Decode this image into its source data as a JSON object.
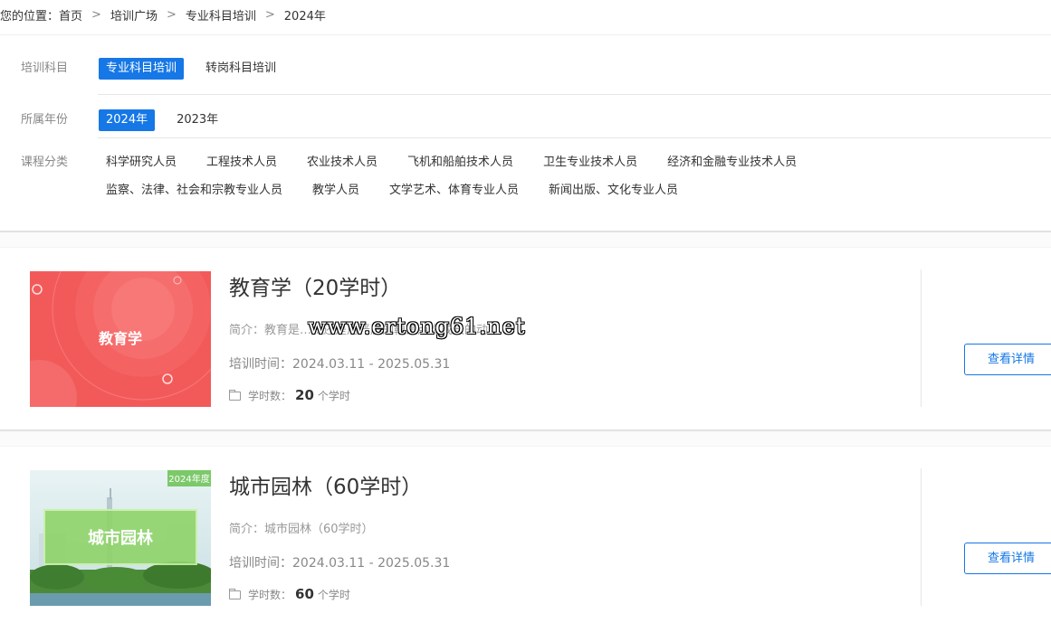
{
  "breadcrumb": {
    "prefix": "您的位置：",
    "items": [
      "首页",
      "培训广场",
      "专业科目培训",
      "2024年"
    ],
    "separator": ">"
  },
  "filters": {
    "subject": {
      "label": "培训科目",
      "options": [
        "专业科目培训",
        "转岗科目培训"
      ],
      "active": "专业科目培训"
    },
    "year": {
      "label": "所属年份",
      "options": [
        "2024年",
        "2023年"
      ],
      "active": "2024年"
    },
    "category": {
      "label": "课程分类",
      "line1": [
        "科学研究人员",
        "工程技术人员",
        "农业技术人员",
        "飞机和船舶技术人员",
        "卫生专业技术人员",
        "经济和金融专业技术人员"
      ],
      "line2": [
        "监察、法律、社会和宗教专业人员",
        "教学人员",
        "文学艺术、体育专业人员",
        "新闻出版、文化专业人员"
      ]
    }
  },
  "courses": [
    {
      "title": "教育学（20学时）",
      "thumb_text": "教育学",
      "intro_label": "简介：",
      "intro": "教育是……还是用严厉的鞭策点燃成长的动...",
      "time_label": "培训时间：",
      "time": "2024.03.11 - 2025.05.31",
      "hours_label": "学时数：",
      "hours": "20",
      "hours_unit": "个学时",
      "button": "查看详情",
      "thumb_color": "#f25a5a"
    },
    {
      "title": "城市园林（60学时）",
      "thumb_text": "城市园林",
      "thumb_badge": "2024年度",
      "intro_label": "简介：",
      "intro": "城市园林（60学时）",
      "time_label": "培训时间：",
      "time": "2024.03.11 - 2025.05.31",
      "hours_label": "学时数：",
      "hours": "60",
      "hours_unit": "个学时",
      "button": "查看详情",
      "thumb_color": "#7cc96a"
    }
  ],
  "watermark": "www.ertong61.net",
  "colors": {
    "accent": "#1677e6"
  }
}
